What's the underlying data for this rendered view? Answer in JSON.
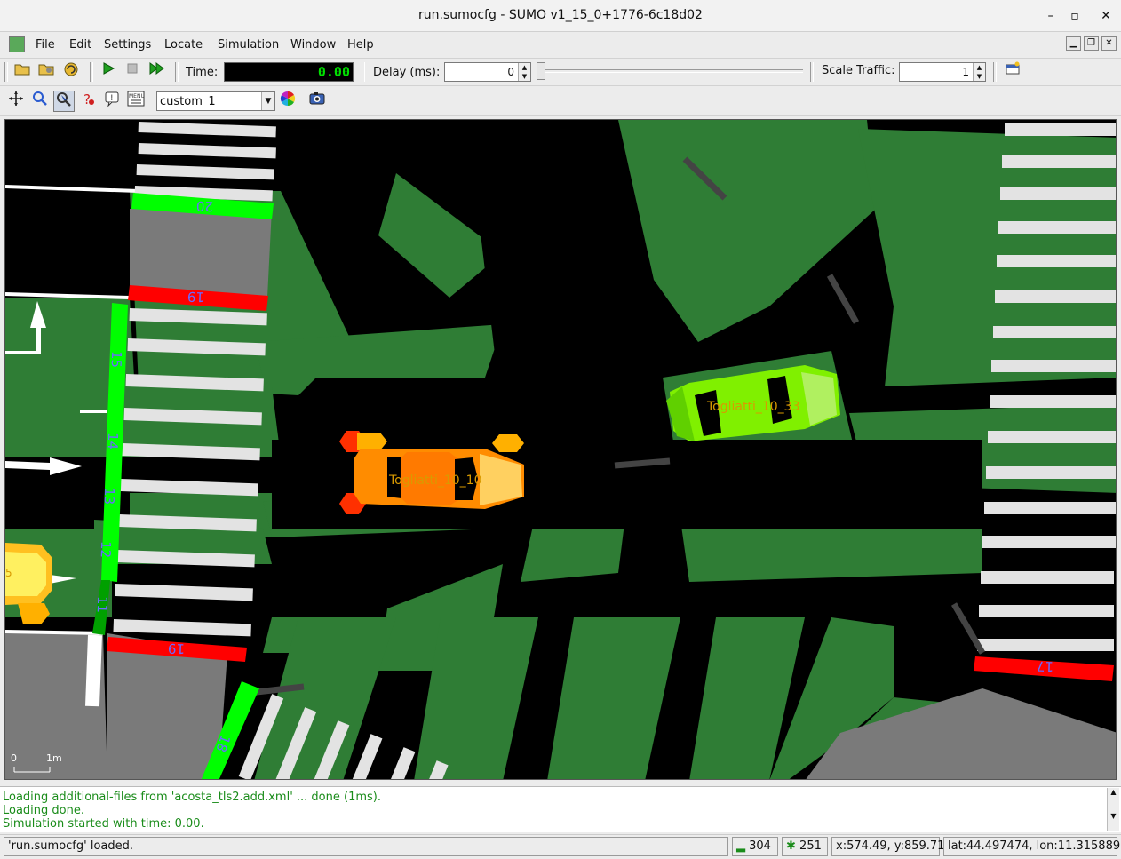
{
  "window": {
    "title": "run.sumocfg - SUMO v1_15_0+1776-6c18d02",
    "minimize": "–",
    "maximize": "▫",
    "close": "✕"
  },
  "menu": {
    "items": [
      {
        "label": "File",
        "mnemonic": "F"
      },
      {
        "label": "Edit",
        "mnemonic": "E"
      },
      {
        "label": "Settings",
        "mnemonic": "S"
      },
      {
        "label": "Locate",
        "mnemonic": "L"
      },
      {
        "label": "Simulation",
        "mnemonic": "S"
      },
      {
        "label": "Window",
        "mnemonic": "W"
      },
      {
        "label": "Help",
        "mnemonic": "H"
      }
    ]
  },
  "toolbar": {
    "time_label": "Time:",
    "time_value": "0.00",
    "delay_label": "Delay (ms):",
    "delay_value": "0",
    "scale_label": "Scale Traffic:",
    "scale_value": "1"
  },
  "view_toolbar": {
    "viewport_scheme": "custom_1"
  },
  "scene": {
    "vehicles": [
      {
        "id": "Togliatti_10_10",
        "color": "#ff8c00"
      },
      {
        "id": "Togliatti_10_33",
        "color": "#80f000"
      }
    ],
    "tls_indices": [
      "20",
      "19",
      "15",
      "14",
      "13",
      "12",
      "11",
      "19",
      "17",
      "18",
      "5"
    ],
    "scale_zero": "0",
    "scale_unit": "1m"
  },
  "messages": {
    "lines": [
      "Loading additional-files from 'acosta_tls2.add.xml' ... done (1ms).",
      "Loading done.",
      "Simulation started with time: 0.00."
    ]
  },
  "status": {
    "message": "'run.sumocfg' loaded.",
    "vehicles": "304",
    "persons": "251",
    "coords": "x:574.49, y:859.71",
    "geo": "lat:44.497474, lon:11.315889"
  },
  "colors": {
    "accent_green": "#00ff00",
    "signal_red": "#ff0000",
    "grass": "#2f7d35",
    "road": "#000000",
    "message_green": "#1a8c1a"
  }
}
